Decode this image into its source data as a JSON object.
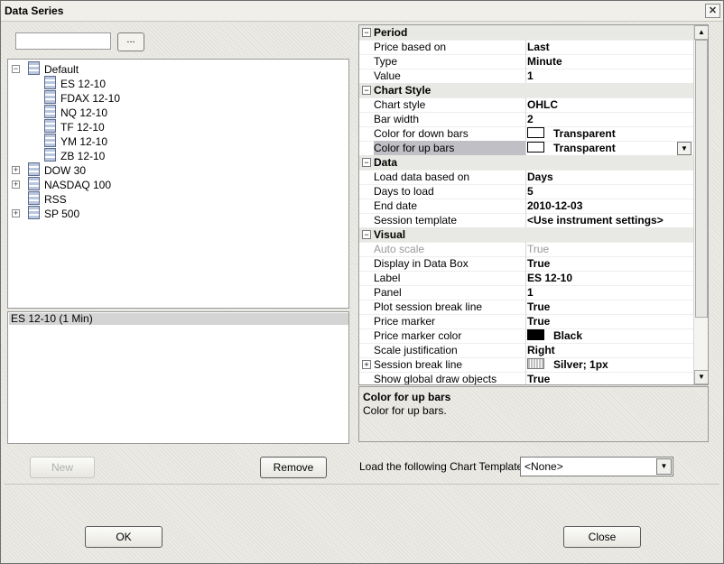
{
  "window": {
    "title": "Data Series",
    "close_glyph": "✕"
  },
  "search": {
    "value": "",
    "browse_label": "..."
  },
  "tree": {
    "default": "Default",
    "default_items": [
      "ES 12-10",
      "FDAX 12-10",
      "NQ 12-10",
      "TF 12-10",
      "YM 12-10",
      "ZB 12-10"
    ],
    "groups": [
      "DOW 30",
      "NASDAQ 100",
      "RSS",
      "SP 500"
    ]
  },
  "selected": {
    "item": "ES 12-10 (1 Min)"
  },
  "buttons": {
    "new": "New",
    "remove": "Remove",
    "ok": "OK",
    "close": "Close"
  },
  "properties": {
    "period": {
      "title": "Period",
      "rows": [
        {
          "name": "Price based on",
          "value": "Last"
        },
        {
          "name": "Type",
          "value": "Minute"
        },
        {
          "name": "Value",
          "value": "1"
        }
      ]
    },
    "chart_style": {
      "title": "Chart Style",
      "rows": [
        {
          "name": "Chart style",
          "value": "OHLC"
        },
        {
          "name": "Bar width",
          "value": "2"
        },
        {
          "name": "Color for down bars",
          "value": "Transparent"
        },
        {
          "name": "Color for up bars",
          "value": "Transparent"
        }
      ]
    },
    "data": {
      "title": "Data",
      "rows": [
        {
          "name": "Load data based on",
          "value": "Days"
        },
        {
          "name": "Days to load",
          "value": "5"
        },
        {
          "name": "End date",
          "value": "2010-12-03"
        },
        {
          "name": "Session template",
          "value": "<Use instrument settings>"
        }
      ]
    },
    "visual": {
      "title": "Visual",
      "rows": [
        {
          "name": "Auto scale",
          "value": "True"
        },
        {
          "name": "Display in Data Box",
          "value": "True"
        },
        {
          "name": "Label",
          "value": "ES 12-10"
        },
        {
          "name": "Panel",
          "value": "1"
        },
        {
          "name": "Plot session break line",
          "value": "True"
        },
        {
          "name": "Price marker",
          "value": "True"
        },
        {
          "name": "Price marker color",
          "value": "Black"
        },
        {
          "name": "Scale justification",
          "value": "Right"
        },
        {
          "name": "Session break line",
          "value": "Silver;  1px"
        },
        {
          "name": "Show global draw objects",
          "value": "True"
        }
      ]
    }
  },
  "colors": {
    "transparent_swatch": "#ffffff",
    "black_swatch": "#000000",
    "silver_swatch": "#c0c0c0",
    "selected_row": "#bfbfc5"
  },
  "description": {
    "title": "Color for up bars",
    "text": "Color for up bars."
  },
  "template": {
    "label": "Load the following Chart Template:",
    "value": "<None>"
  }
}
